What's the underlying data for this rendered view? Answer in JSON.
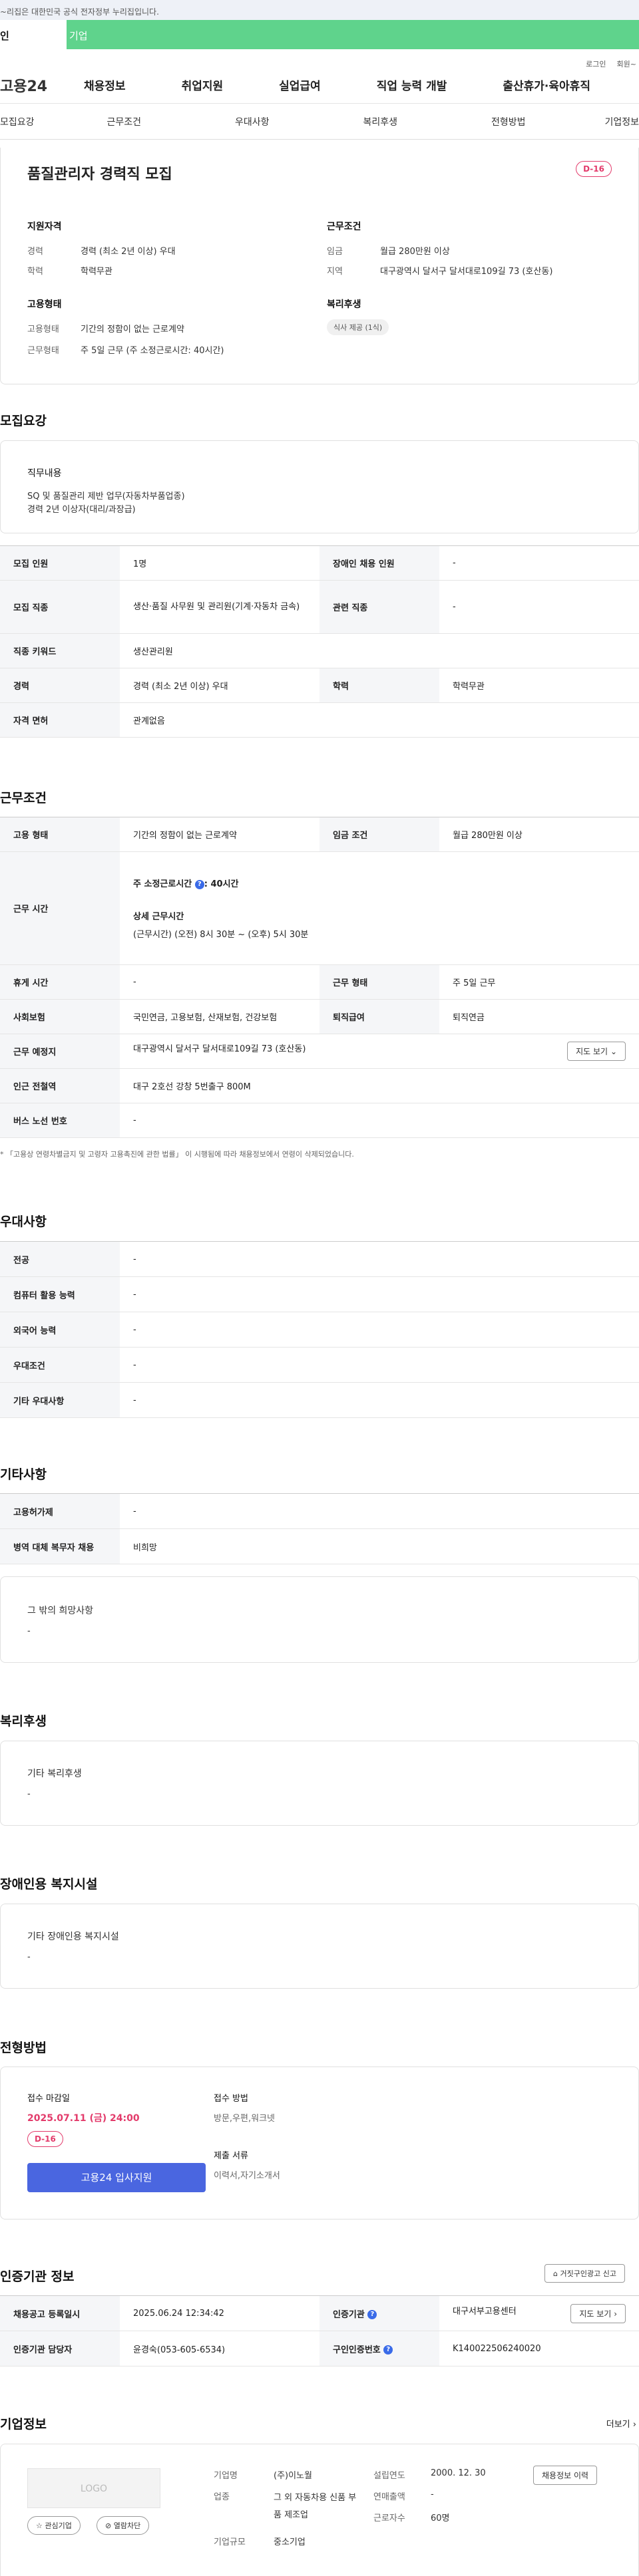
{
  "gov": {
    "notice": "~리집은 대한민국 공식 전자정부 누리집입니다."
  },
  "gtabs": {
    "personal": "인",
    "company": "기업"
  },
  "util": {
    "login": "로그인",
    "join": "회원~"
  },
  "gnb": {
    "logo": "고용24",
    "menu": [
      "채용정보",
      "취업지원",
      "실업급여",
      "직업 능력 개발",
      "출산휴가·육아휴직"
    ]
  },
  "subnav": [
    "모집요강",
    "근무조건",
    "우대사항",
    "복리후생",
    "전형방법",
    "기업정보"
  ],
  "top": {
    "title": "품질관리자 경력직 모집",
    "dday": "D-16",
    "qual_h": "지원자격",
    "career_l": "경력",
    "career_v": "경력 (최소 2년 이상) 우대",
    "edu_l": "학력",
    "edu_v": "학력무관",
    "cond_h": "근무조건",
    "wage_l": "임금",
    "wage_v": "월급 280만원 이상",
    "area_l": "지역",
    "area_v": "대구광역시 달서구 달서대로109길 73 (호산동)",
    "emp_h": "고용형태",
    "emptype_l": "고용형태",
    "emptype_v": "기간의 정함이 없는 근로계약",
    "worktype_l": "근무형태",
    "worktype_v": "주 5일 근무 (주 소정근로시간: 40시간)",
    "wel_h": "복리후생",
    "wel_badge": "식사 제공 (1식)"
  },
  "recruit": {
    "h": "모집요강",
    "duty_l": "직무내용",
    "duty_v1": "SQ 및 품질관리 제반 업무(자동차부품업종)",
    "duty_v2": "경력 2년 이상자(대리/과장급)",
    "rows": {
      "n_l": "모집 인원",
      "n_v": "1명",
      "dis_l": "장애인 채용 인원",
      "dis_v": "-",
      "job_l": "모집 직종",
      "job_v": "생산·품질 사무원 및 관리원(기계·자동차 금속)",
      "rel_l": "관련 직종",
      "rel_v": "-",
      "kw_l": "직종 키워드",
      "kw_v": "생산관리원",
      "car_l": "경력",
      "car_v": "경력 (최소 2년 이상) 우대",
      "edu_l": "학력",
      "edu_v": "학력무관",
      "lic_l": "자격 면허",
      "lic_v": "관계없음"
    }
  },
  "work": {
    "h": "근무조건",
    "emp_l": "고용 형태",
    "emp_v": "기간의 정함이 없는 근로계약",
    "wage_l": "임금 조건",
    "wage_v": "월급 280만원 이상",
    "hours_l": "근무 시간",
    "hours_v1": "주 소정근로시간",
    "hours_v1b": ": 40시간",
    "hours_v2": "상세 근무시간",
    "hours_v3": "(근무시간) (오전) 8시 30분 ~ (오후) 5시 30분",
    "rest_l": "휴게 시간",
    "rest_v": "-",
    "form_l": "근무 형태",
    "form_v": "주 5일 근무",
    "ins_l": "사회보험",
    "ins_v": "국민연금, 고용보험, 산재보험, 건강보험",
    "ret_l": "퇴직급여",
    "ret_v": "퇴직연금",
    "loc_l": "근무 예정지",
    "loc_v": "대구광역시 달서구 달서대로109길 73 (호산동)",
    "map_btn": "지도 보기",
    "sub_l": "인근 전철역",
    "sub_v": "대구 2호선 강창 5번출구 800M",
    "bus_l": "버스 노선 번호",
    "bus_v": "-",
    "note": "* 「고용상 연령차별금지 및 고령자 고용촉진에 관한 법률」 이 시행됨에 따라 채용정보에서 연령이 삭제되었습니다."
  },
  "pref": {
    "h": "우대사항",
    "r1_l": "전공",
    "r1_v": "-",
    "r2_l": "컴퓨터 활용 능력",
    "r2_v": "-",
    "r3_l": "외국어 능력",
    "r3_v": "-",
    "r4_l": "우대조건",
    "r4_v": "-",
    "r5_l": "기타 우대사항",
    "r5_v": "-"
  },
  "etc": {
    "h": "기타사항",
    "r1_l": "고용허가제",
    "r1_v": "-",
    "r2_l": "병역 대체 복무자 채용",
    "r2_v": "비희망",
    "box_l": "그 밖의 희망사항",
    "box_v": "-"
  },
  "welfare": {
    "h": "복리후생",
    "box_l": "기타 복리후생",
    "box_v": "-"
  },
  "disab": {
    "h": "장애인용 복지시설",
    "box_l": "기타 장애인용 복지시설",
    "box_v": "-"
  },
  "sel": {
    "h": "전형방법",
    "dl_l": "접수 마감일",
    "dl_v": "2025.07.11 (금) 24:00",
    "dday": "D-16",
    "apply": "고용24 입사지원",
    "method_l": "접수 방법",
    "method_v": "방문,우편,워크넷",
    "docs_l": "제출 서류",
    "docs_v": "이력서,자기소개서"
  },
  "cert": {
    "h": "인증기관 정보",
    "report": "거짓구인광고 신고",
    "reg_l": "채용공고 등록일시",
    "reg_v": "2025.06.24 12:34:42",
    "org_l": "인증기관",
    "org_v": "대구서부고용센터",
    "map_btn": "지도 보기",
    "mgr_l": "인증기관 담당자",
    "mgr_v": "윤경숙(053-605-6534)",
    "num_l": "구인인증번호",
    "num_v": "K140022506240020"
  },
  "comp": {
    "h": "기업정보",
    "more": "더보기",
    "logo": "LOGO",
    "fav": "관심기업",
    "block": "열람차단",
    "name_l": "기업명",
    "name_v": "(주)이노월",
    "ind_l": "업종",
    "ind_v": "그 외 자동차용 신품 부품 제조업",
    "size_l": "기업규모",
    "size_v": "중소기업",
    "est_l": "설립연도",
    "est_v": "2000. 12. 30",
    "sales_l": "연매출액",
    "sales_v": "-",
    "emp_l": "근로자수",
    "emp_v": "60명",
    "hist_btn": "채용정보 이력"
  }
}
